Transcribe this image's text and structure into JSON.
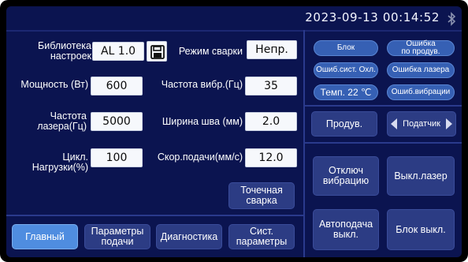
{
  "status_bar": {
    "datetime": "2023-09-13 00:14:52",
    "bluetooth_icon": "bluetooth-icon"
  },
  "library": {
    "label_line1": "Библиотека",
    "label_line2": "настроек",
    "value": "AL    1.0",
    "save_icon": "floppy-disk-icon"
  },
  "weld_mode": {
    "label": "Режим сварки",
    "value": "Непр."
  },
  "power": {
    "label": "Мощность (Вт)",
    "value": "600"
  },
  "wobble_freq": {
    "label": "Частота вибр.(Гц)",
    "value": "35"
  },
  "laser_freq": {
    "label_line1": "Частота",
    "label_line2": "лазера(Гц)",
    "value": "5000"
  },
  "seam_width": {
    "label": "Ширина шва (мм)",
    "value": "2.0"
  },
  "duty_cycle": {
    "label": "Цикл. Нагрузки(%)",
    "value": "100"
  },
  "feed_speed": {
    "label": "Скор.подачи(мм/с)",
    "value": "12.0"
  },
  "spot_weld": {
    "line1": "Точечная",
    "line2": "сварка"
  },
  "nav": {
    "main": "Главный",
    "feed_line1": "Параметры",
    "feed_line2": "подачи",
    "diagnostics": "Диагностика",
    "sys_line1": "Сист.",
    "sys_line2": "параметры"
  },
  "status_indicators": {
    "lock": "Блок",
    "blow_err_line1": "Ошибка",
    "blow_err_line2": "по продув.",
    "cooling_err": "Ошиб.сист. Охл.",
    "laser_err": "Ошибка лазера",
    "temp": "Темп.  22 ℃",
    "wobble_err": "Ошиб.вибрации"
  },
  "purge": "Продув.",
  "feeder": "Податчик",
  "controls": {
    "vibration_off_line1": "Отключ",
    "vibration_off_line2": "вибрацию",
    "laser_off": "Выкл.лазер",
    "autofeed_line1": "Автоподача",
    "autofeed_line2": "выкл.",
    "lock_off": "Блок выкл."
  },
  "colors": {
    "background": "#0b1450",
    "button": "#2c3c84",
    "active_tab": "#4f8de0",
    "indicator": "#3660b4"
  }
}
